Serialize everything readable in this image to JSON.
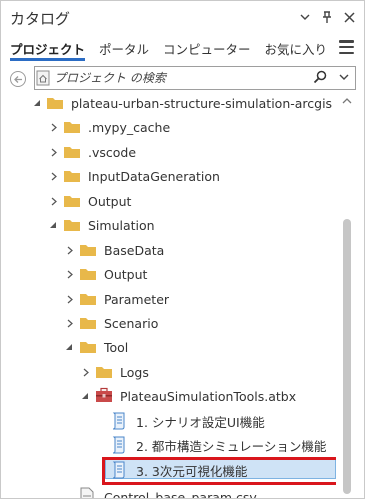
{
  "window": {
    "title": "カタログ"
  },
  "tabs": [
    {
      "label": "プロジェクト",
      "active": true
    },
    {
      "label": "ポータル",
      "active": false
    },
    {
      "label": "コンピューター",
      "active": false
    },
    {
      "label": "お気に入り",
      "active": false
    }
  ],
  "search": {
    "placeholder": "プロジェクト の検索"
  },
  "tree": {
    "items": [
      {
        "label": "plateau-urban-structure-simulation-arcgis",
        "type": "folder",
        "expanded": true,
        "level": 0
      },
      {
        "label": ".mypy_cache",
        "type": "folder",
        "expanded": false,
        "level": 1
      },
      {
        "label": ".vscode",
        "type": "folder",
        "expanded": false,
        "level": 1
      },
      {
        "label": "InputDataGeneration",
        "type": "folder",
        "expanded": false,
        "level": 1
      },
      {
        "label": "Output",
        "type": "folder",
        "expanded": false,
        "level": 1
      },
      {
        "label": "Simulation",
        "type": "folder",
        "expanded": true,
        "level": 1
      },
      {
        "label": "BaseData",
        "type": "folder",
        "expanded": false,
        "level": 2
      },
      {
        "label": "Output",
        "type": "folder",
        "expanded": false,
        "level": 2
      },
      {
        "label": "Parameter",
        "type": "folder",
        "expanded": false,
        "level": 2
      },
      {
        "label": "Scenario",
        "type": "folder",
        "expanded": false,
        "level": 2
      },
      {
        "label": "Tool",
        "type": "folder",
        "expanded": true,
        "level": 2
      },
      {
        "label": "Logs",
        "type": "folder",
        "expanded": false,
        "level": 3
      },
      {
        "label": "PlateauSimulationTools.atbx",
        "type": "toolbox",
        "expanded": true,
        "level": 3
      },
      {
        "label": "1. シナリオ設定UI機能",
        "type": "script",
        "level": 4
      },
      {
        "label": "2. 都市構造シミュレーション機能",
        "type": "script",
        "level": 4
      },
      {
        "label": "3. 3次元可視化機能",
        "type": "script",
        "level": 4,
        "selected": true
      },
      {
        "label": "Control_base_param.csv",
        "type": "file",
        "level": 1
      }
    ]
  },
  "colors": {
    "folder": "#e8b84a",
    "selection": "#cfe3f6",
    "highlight_border": "#d9161c",
    "tab_underline": "#2b6cc4"
  }
}
